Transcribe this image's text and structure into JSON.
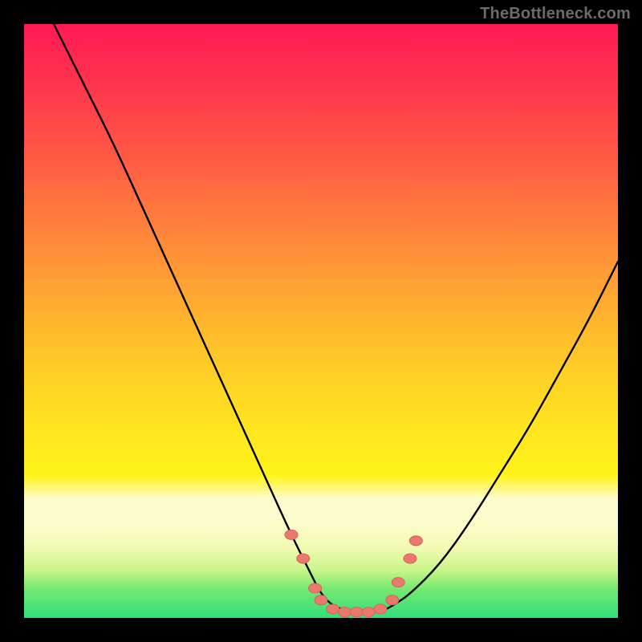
{
  "watermark": {
    "text": "TheBottleneck.com"
  },
  "colors": {
    "frame": "#000000",
    "curve_stroke": "#000000",
    "marker_fill": "#e9786d",
    "marker_stroke": "#d56359"
  },
  "chart_data": {
    "type": "line",
    "title": "",
    "xlabel": "",
    "ylabel": "",
    "xlim": [
      0,
      100
    ],
    "ylim": [
      0,
      100
    ],
    "grid": false,
    "legend": false,
    "note": "Values estimated from pixels; axes are unlabeled in the source image. y=0 is the bottom (green) edge.",
    "series": [
      {
        "name": "bottleneck-curve",
        "x": [
          5,
          10,
          15,
          20,
          25,
          30,
          35,
          40,
          45,
          48,
          50,
          52,
          55,
          57,
          60,
          62,
          65,
          70,
          75,
          80,
          85,
          90,
          95,
          100
        ],
        "y": [
          100,
          90,
          80,
          69,
          58,
          47,
          36,
          25,
          14,
          8,
          4,
          2,
          1,
          1,
          1,
          2,
          4,
          9,
          16,
          24,
          32,
          41,
          50,
          60
        ]
      }
    ],
    "markers": {
      "name": "highlight-dots",
      "note": "Salmon dots near the trough of the curve.",
      "points": [
        {
          "x": 45,
          "y": 14
        },
        {
          "x": 47,
          "y": 10
        },
        {
          "x": 49,
          "y": 5
        },
        {
          "x": 50,
          "y": 3
        },
        {
          "x": 52,
          "y": 1.5
        },
        {
          "x": 54,
          "y": 1
        },
        {
          "x": 56,
          "y": 1
        },
        {
          "x": 58,
          "y": 1
        },
        {
          "x": 60,
          "y": 1.5
        },
        {
          "x": 62,
          "y": 3
        },
        {
          "x": 63,
          "y": 6
        },
        {
          "x": 65,
          "y": 10
        },
        {
          "x": 66,
          "y": 13
        }
      ]
    }
  }
}
